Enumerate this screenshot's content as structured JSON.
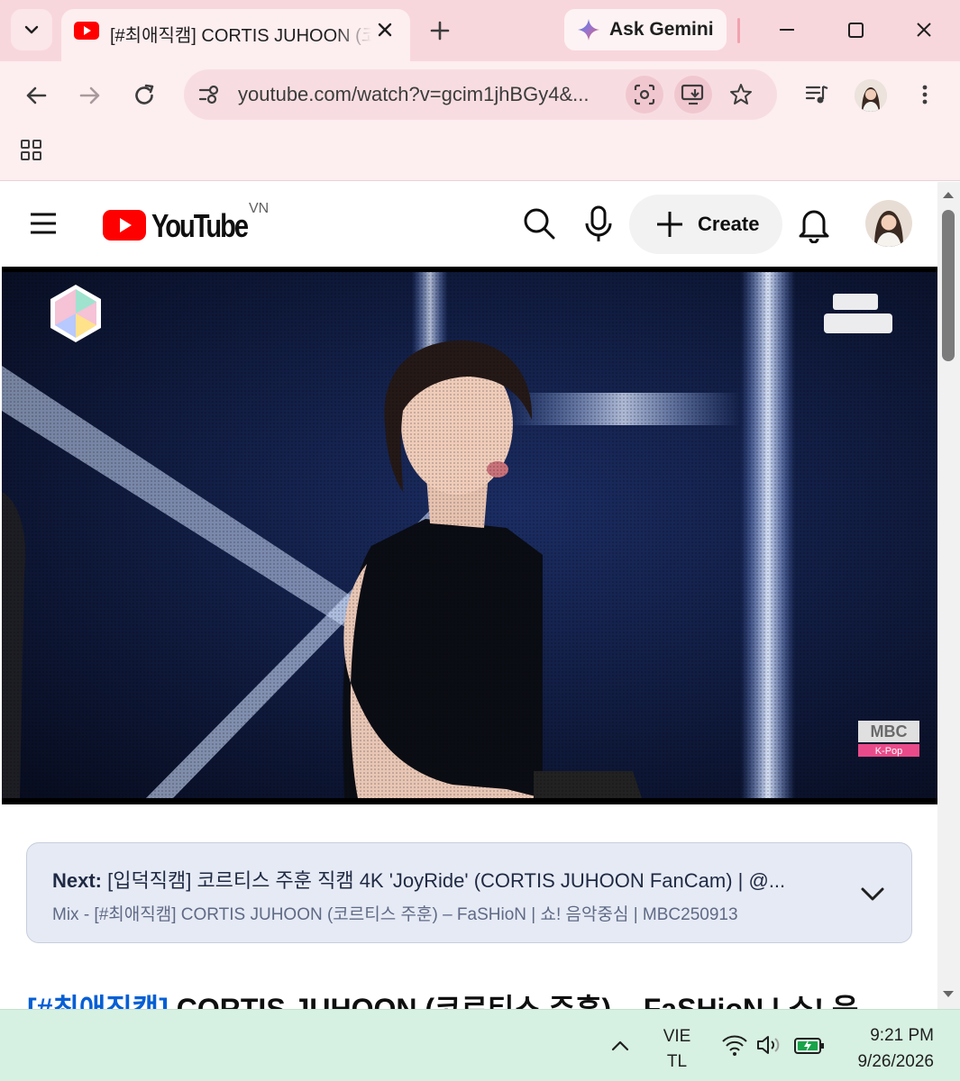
{
  "browser": {
    "tab": {
      "title": "[#최애직캠] CORTIS JUHOON (코르티스 주훈) – FaSHioN"
    },
    "gemini_label": "Ask Gemini",
    "address": {
      "url": "youtube.com/watch?v=gcim1jhBGy4&..."
    }
  },
  "youtube": {
    "region": "VN",
    "create_label": "Create",
    "player": {
      "watermark_brand": "MBC",
      "watermark_sub": "K-Pop"
    },
    "next": {
      "prefix": "Next:",
      "title": "[입덕직캠] 코르티스 주훈 직캠 4K 'JoyRide' (CORTIS JUHOON FanCam) | @...",
      "mix": "Mix - [#최애직캠] CORTIS JUHOON (코르티스 주훈) – FaSHioN | 쇼! 음악중심 | MBC250913"
    },
    "video_title_tag": "[#최애직캠]",
    "video_title_rest": " CORTIS JUHOON (코르티스 주훈) – FaSHioN | 쇼! 음"
  },
  "taskbar": {
    "lang_top": "VIE",
    "lang_bottom": "TL",
    "time": "9:21 PM",
    "date": "9/26/2026"
  },
  "colors": {
    "tabstrip": "#f8d7dc",
    "toolbar": "#fdeef0",
    "youtube_red": "#ff0000",
    "taskbar": "#d6f0e1",
    "next_bar": "#e6eaf4",
    "link_blue": "#065fd4"
  }
}
